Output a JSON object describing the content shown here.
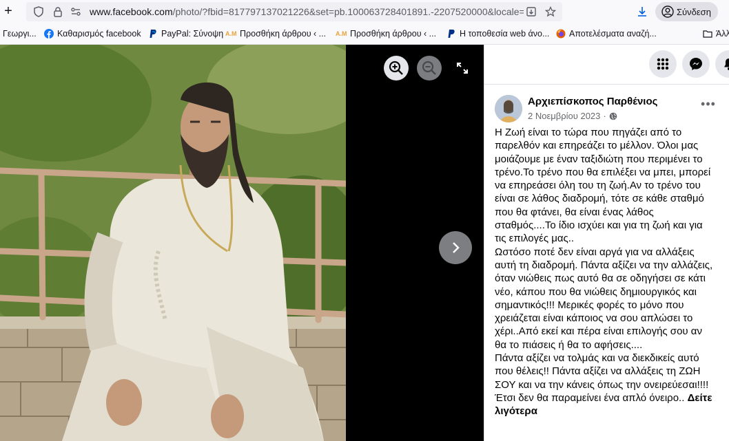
{
  "browser": {
    "url_host": "www.facebook.com",
    "url_rest": "/photo/?fbid=817797137021226&set=pb.100063728401891.-2207520000&locale=el",
    "signin_label": "Σύνδεση"
  },
  "bookmarks": [
    {
      "label": "Γεωργι...",
      "color": "#f9f9fb"
    },
    {
      "label": "Καθαρισμός facebook",
      "color": "#1877f2"
    },
    {
      "label": "PayPal: Σύνοψη",
      "color": "#003087"
    },
    {
      "label": "Προσθήκη άρθρου ‹ ...",
      "color": "#e8a33c"
    },
    {
      "label": "Προσθήκη άρθρου ‹ ...",
      "color": "#e8a33c"
    },
    {
      "label": "Η τοποθεσία web άνο...",
      "color": "#003087"
    },
    {
      "label": "Αποτελέσματα αναζή...",
      "color": "#e66000"
    },
    {
      "label": "Άλλ",
      "color": "#f9f9fb"
    }
  ],
  "post": {
    "author": "Αρχιεπίσκοπος Παρθένιος",
    "date": "2 Νοεμβρίου 2023",
    "date_sep": "·",
    "more": "•••",
    "paragraphs": [
      "Η Ζωή είναι το τώρα που πηγάζει από το παρελθόν και επηρεάζει το μέλλον. Όλοι μας μοιάζουμε με έναν ταξιδιώτη που περιμένει το τρένο.Το τρένο που θα επιλέξει να μπει, μπορεί να επηρεάσει όλη του τη ζωή.Αν το τρένο του είναι σε λάθος διαδρομή, τότε σε κάθε σταθμό που θα φτάνει, θα είναι ένας λάθος σταθμός....Το ίδιο ισχύει και για τη ζωή και για τις επιλογές μας..",
      "Ωστόσο ποτέ δεν είναι αργά για να αλλάξεις αυτή τη διαδρομή. Πάντα αξίζει να την αλλάζεις, όταν νιώθεις πως αυτό θα σε οδηγήσει σε κάτι νέο, κάπου που θα νιώθεις δημιουργικός και σημαντικός!!! Μερικές φορές το μόνο που χρειάζεται είναι κάποιος να σου απλώσει το χέρι..Από εκεί και πέρα είναι επιλογής σου αν θα το πιάσεις ή θα το αφήσεις....",
      "Πάντα αξίζει να τολμάς και να διεκδικείς αυτό που θέλεις!! Πάντα αξίζει να αλλάξεις τη ΖΩΗ ΣΟΥ και να την κάνεις όπως την ονειρεύεσαι!!!! Έτσι δεν θα παραμείνει ένα απλό όνειρο.."
    ],
    "see_more": "Δείτε λιγότερα"
  }
}
